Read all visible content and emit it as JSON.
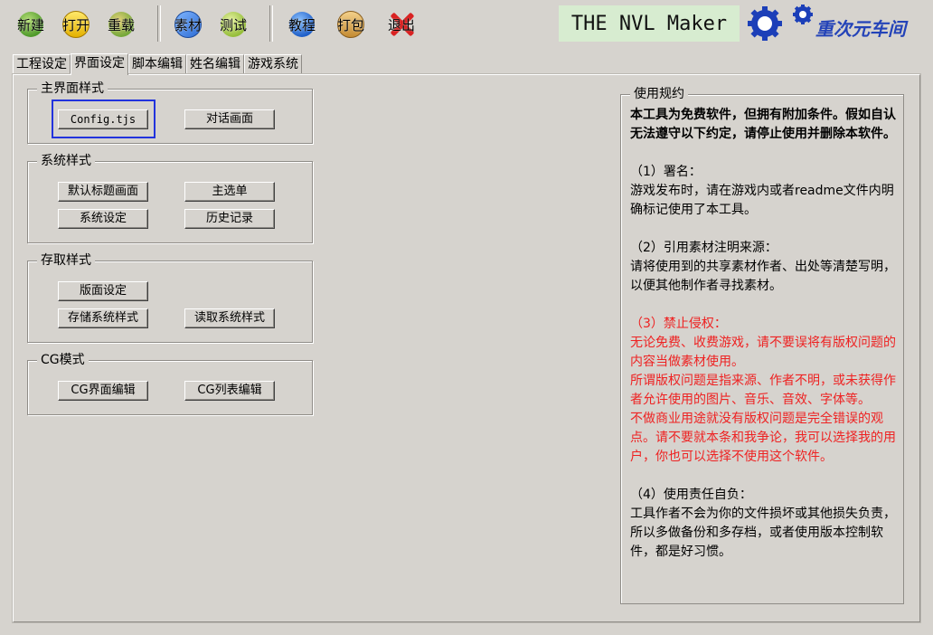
{
  "toolbar": {
    "new_label": "新建",
    "open_label": "打开",
    "reload_label": "重载",
    "assets_label": "素材",
    "test_label": "测试",
    "tutorial_label": "教程",
    "pack_label": "打包",
    "exit_label": "退出",
    "logo_text": "THE NVL Maker",
    "brand_text": "重次元车间"
  },
  "tabs": [
    {
      "label": "工程设定"
    },
    {
      "label": "界面设定"
    },
    {
      "label": "脚本编辑"
    },
    {
      "label": "姓名编辑"
    },
    {
      "label": "游戏系统"
    }
  ],
  "active_tab": "界面设定",
  "groups": {
    "main": {
      "title": "主界面样式",
      "buttons": [
        "Config.tjs",
        "对话画面"
      ]
    },
    "system": {
      "title": "系统样式",
      "buttons": [
        "默认标题画面",
        "主选单",
        "系统设定",
        "历史记录"
      ]
    },
    "save": {
      "title": "存取样式",
      "buttons": [
        "版面设定",
        "存储系统样式",
        "读取系统样式"
      ]
    },
    "cg": {
      "title": "CG模式",
      "buttons": [
        "CG界面编辑",
        "CG列表编辑"
      ]
    }
  },
  "license": {
    "title": "使用规约",
    "intro": "本工具为免费软件，但拥有附加条件。假如自认无法遵守以下约定，请停止使用并删除本软件。",
    "s1_title": "（1）署名：",
    "s1_body": "游戏发布时，请在游戏内或者readme文件内明确标记使用了本工具。",
    "s2_title": "（2）引用素材注明来源：",
    "s2_body": "请将使用到的共享素材作者、出处等清楚写明，以便其他制作者寻找素材。",
    "s3_title": "（3）禁止侵权：",
    "s3_body1": "无论免费、收费游戏，请不要误将有版权问题的内容当做素材使用。",
    "s3_body2": "所谓版权问题是指来源、作者不明，或未获得作者允许使用的图片、音乐、音效、字体等。",
    "s3_body3": "不做商业用途就没有版权问题是完全错误的观点。请不要就本条和我争论，我可以选择我的用户，你也可以选择不使用这个软件。",
    "s4_title": "（4）使用责任自负：",
    "s4_body": "工具作者不会为你的文件损坏或其他损失负责，所以多做备份和多存档，或者使用版本控制软件，都是好习惯。"
  },
  "colors": {
    "background": "#d6d3ce",
    "focus": "#2233dd",
    "warning_text": "#ee2222",
    "logo_bg": "#d7ecd0",
    "brand": "#2443b8"
  }
}
